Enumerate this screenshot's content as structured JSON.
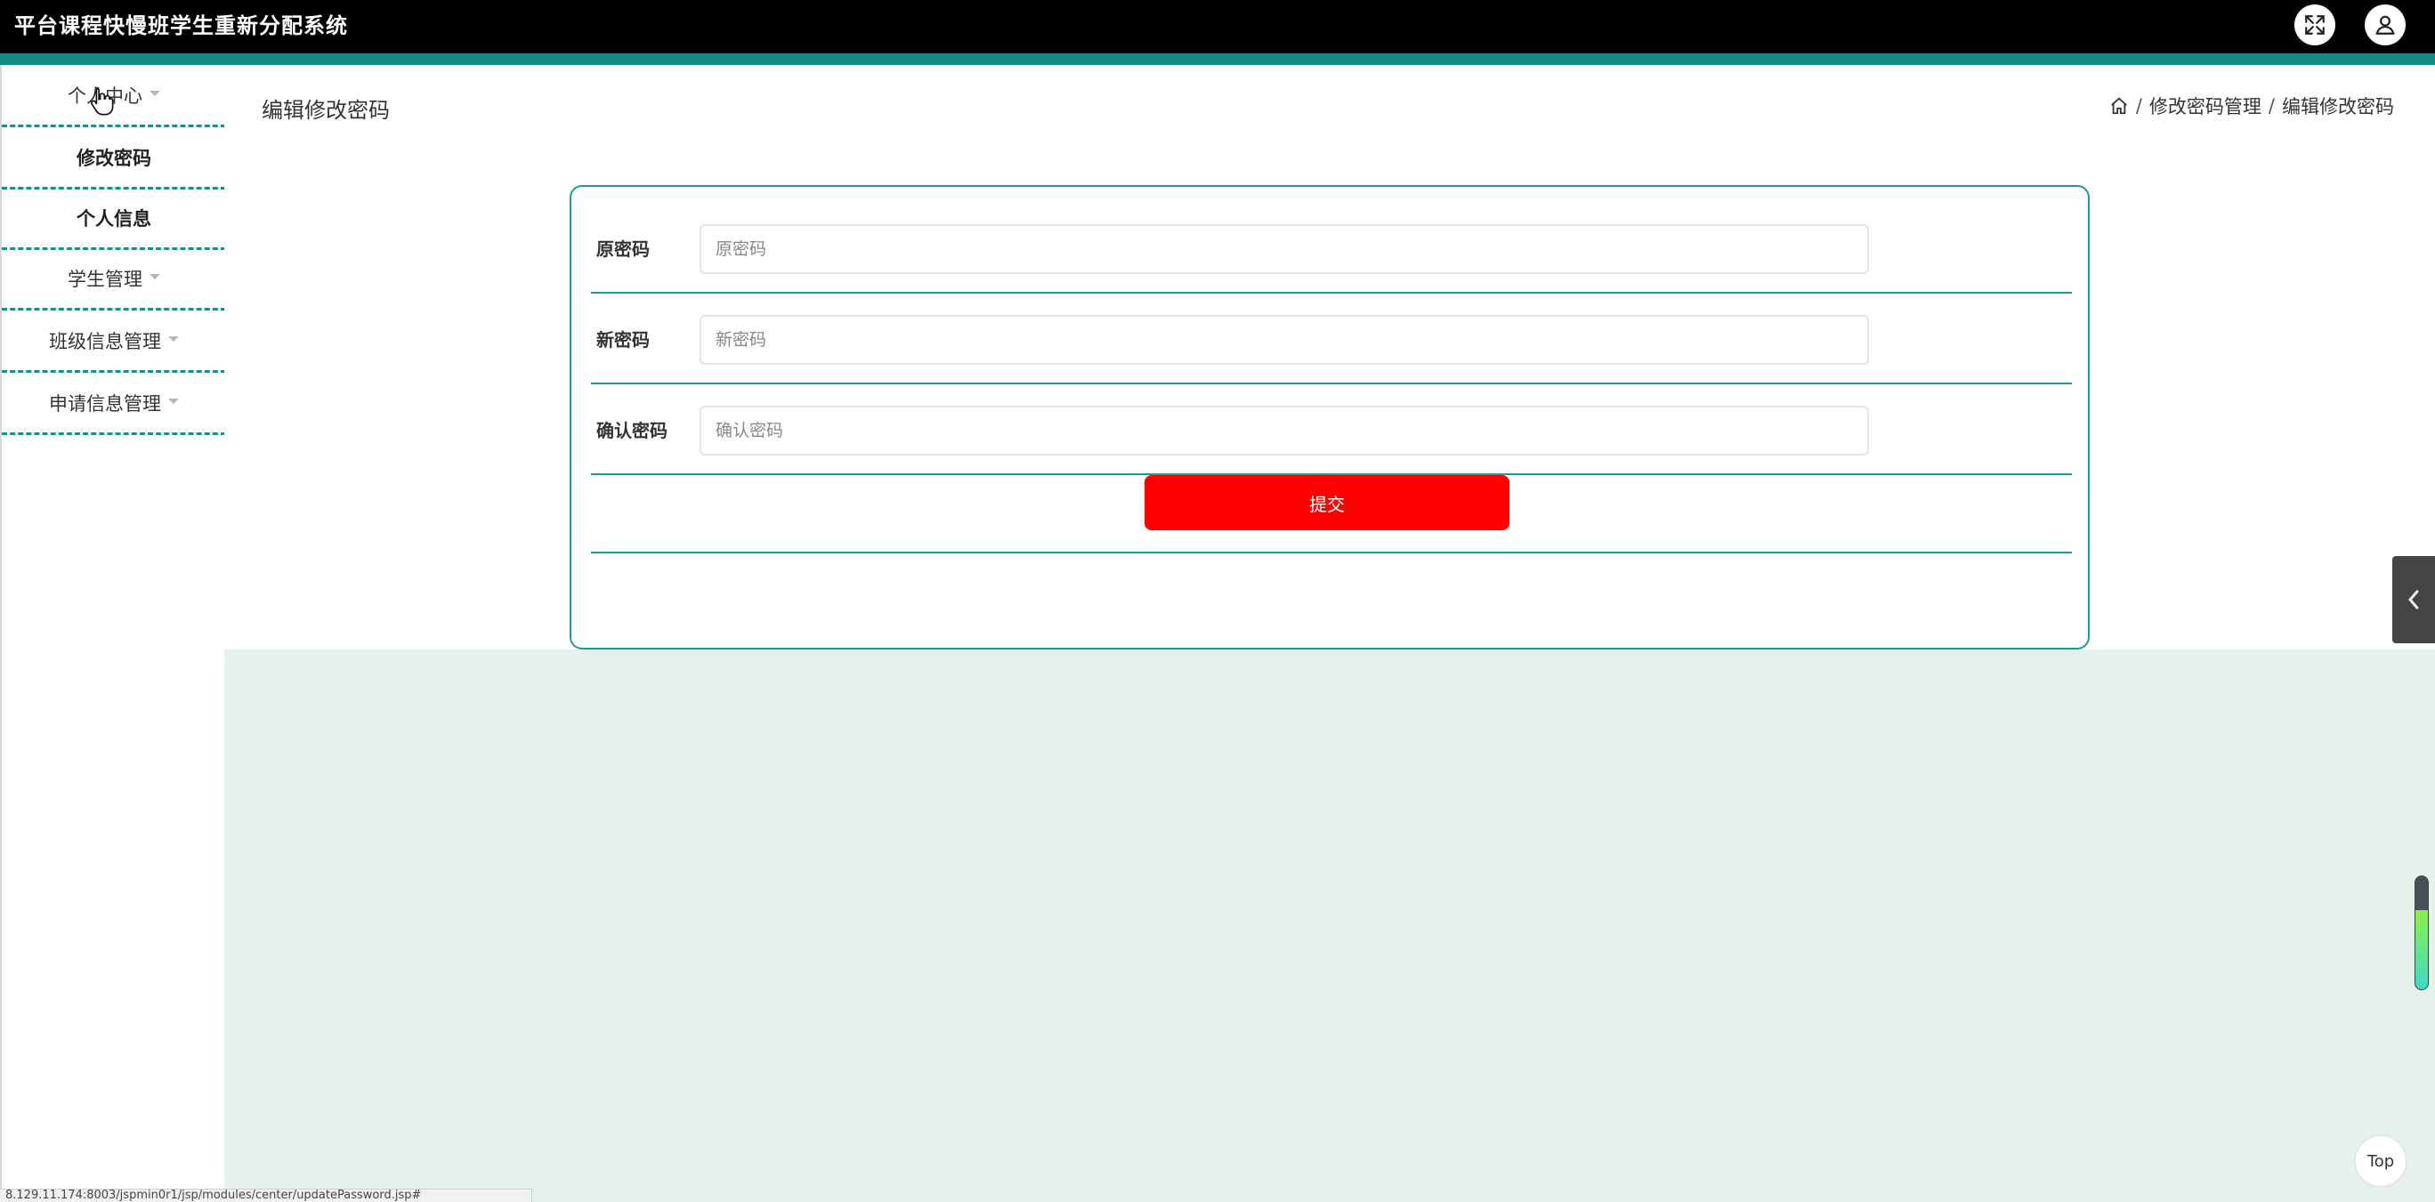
{
  "app": {
    "title": "平台课程快慢班学生重新分配系统"
  },
  "colors": {
    "topbar": "#000000",
    "accent": "#138b84",
    "submit": "#ff0000",
    "mint_background": "#e4f2eb"
  },
  "sidebar": {
    "items": [
      {
        "label": "个人中心",
        "has_caret": true
      },
      {
        "label": "修改密码",
        "sub": true
      },
      {
        "label": "个人信息",
        "sub": true
      },
      {
        "label": "学生管理",
        "has_caret": true
      },
      {
        "label": "班级信息管理",
        "has_caret": true
      },
      {
        "label": "申请信息管理",
        "has_caret": true
      }
    ]
  },
  "page": {
    "title": "编辑修改密码",
    "breadcrumb": [
      "修改密码管理",
      "编辑修改密码"
    ]
  },
  "form": {
    "fields": [
      {
        "label": "原密码",
        "placeholder": "原密码",
        "value": ""
      },
      {
        "label": "新密码",
        "placeholder": "新密码",
        "value": ""
      },
      {
        "label": "确认密码",
        "placeholder": "确认密码",
        "value": ""
      }
    ],
    "submit_label": "提交"
  },
  "widgets": {
    "top_label": "Top",
    "scroll_level": 0.7
  },
  "status_bar": {
    "url": "8.129.11.174:8003/jspmin0r1/jsp/modules/center/updatePassword.jsp#"
  }
}
